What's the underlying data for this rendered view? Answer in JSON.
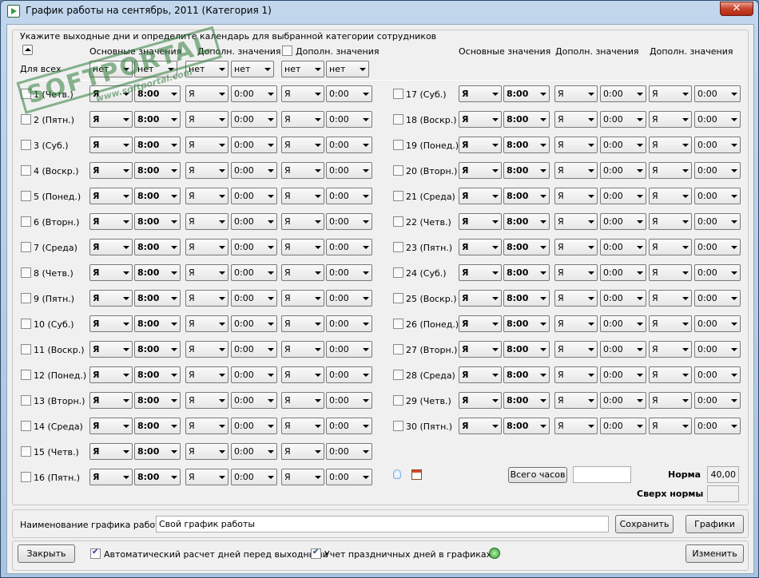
{
  "window": {
    "title": "График работы на сентябрь, 2011 (Категория 1)",
    "close_label": "✕"
  },
  "header": {
    "instruction": "Укажите выходные дни и определите календарь для выбранной категории сотрудников",
    "left_main_label": "Основные значения",
    "left_extra_label": "Дополн. значения",
    "left_extra2_label": "Дополн. значения",
    "right_main_label": "Основные значения",
    "right_extra_label": "Дополн. значения",
    "right_extra2_label": "Дополн. значения",
    "for_all_label": "Для всех",
    "for_all_values": [
      "нет",
      "нет",
      "нет",
      "нет",
      "нет",
      "нет"
    ]
  },
  "row_defaults": {
    "main_code": "Я",
    "main_hours": "8:00",
    "extra_code": "Я",
    "extra_hours": "0:00",
    "extra2_code": "Я",
    "extra2_hours": "0:00"
  },
  "days_left": [
    "1 (Четв.)",
    "2 (Пятн.)",
    "3 (Суб.)",
    "4 (Воскр.)",
    "5 (Понед.)",
    "6 (Вторн.)",
    "7 (Среда)",
    "8 (Четв.)",
    "9 (Пятн.)",
    "10 (Суб.)",
    "11 (Воскр.)",
    "12 (Понед.)",
    "13 (Вторн.)",
    "14 (Среда)",
    "15 (Четв.)",
    "16 (Пятн.)"
  ],
  "days_right": [
    "17 (Суб.)",
    "18 (Воскр.)",
    "19 (Понед.)",
    "20 (Вторн.)",
    "21 (Среда)",
    "22 (Четв.)",
    "23 (Пятн.)",
    "24 (Суб.)",
    "25 (Воскр.)",
    "26 (Понед.)",
    "27 (Вторн.)",
    "28 (Среда)",
    "29 (Четв.)",
    "30 (Пятн.)"
  ],
  "totals": {
    "total_hours_button": "Всего часов",
    "total_hours_value": "",
    "norm_label": "Норма",
    "norm_value": "40,00",
    "over_norm_label": "Сверх нормы",
    "over_norm_value": ""
  },
  "schedule": {
    "name_label": "Наименование графика работы:",
    "name_value": "Свой график работы",
    "save_button": "Сохранить",
    "schedules_button": "Графики"
  },
  "footer": {
    "close_button": "Закрыть",
    "auto_calc_label": "Автоматический расчет дней перед выходными",
    "auto_calc_checked": true,
    "holidays_label": "Учет праздничных дней в графиках",
    "holidays_checked": true,
    "change_button": "Изменить"
  },
  "watermark": {
    "main": "SOFTPORTAL",
    "sub": "www.softportal.com"
  }
}
